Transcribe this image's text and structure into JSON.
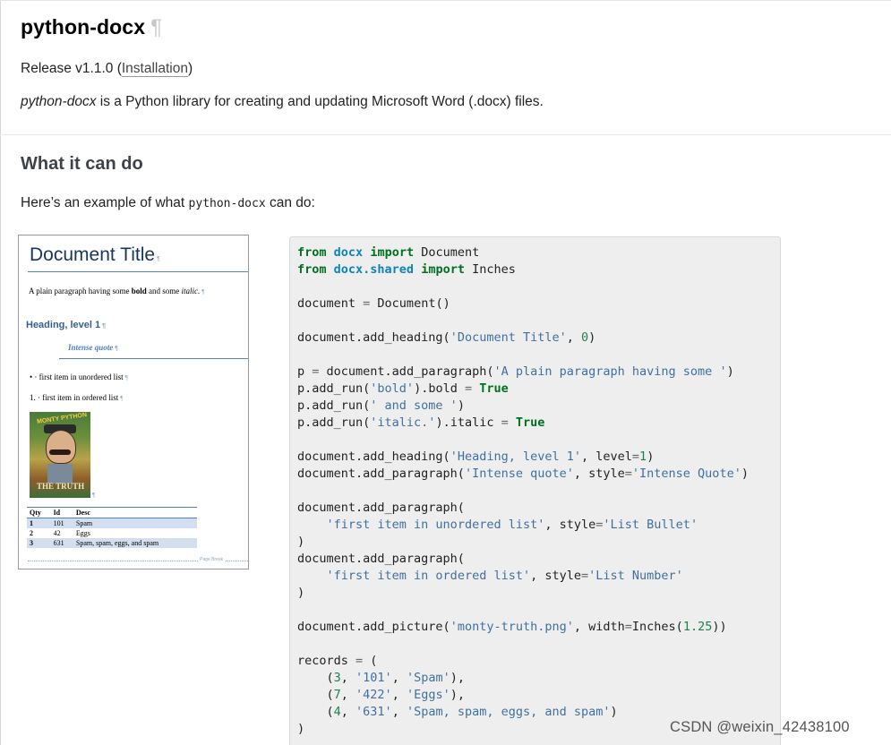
{
  "page": {
    "title": "python-docx",
    "pilcrow": "¶",
    "release_prefix": "Release v1.1.0 (",
    "release_link": "Installation",
    "release_suffix": ")",
    "intro_em": "python-docx",
    "intro_rest": " is a Python library for creating and updating Microsoft Word (.docx) files.",
    "section_heading": "What it can do",
    "example_prefix": "Here’s an example of what ",
    "example_code": "python-docx",
    "example_suffix": " can do:"
  },
  "doc_preview": {
    "title": "Document Title",
    "para_1": "A plain paragraph having some ",
    "para_bold": "bold",
    "para_2": " and some ",
    "para_italic": "italic.",
    "heading": "Heading, level 1",
    "quote": "Intense quote",
    "bullet_item": "• · first item in unordered list",
    "numbered_item": "1. · first item in ordered list",
    "picture_top_text": "MONTY PYTHON",
    "picture_bottom_text": "THE TRUTH",
    "table_headers": [
      "Qty",
      "Id",
      "Desc"
    ],
    "table_rows": [
      [
        "1",
        "101",
        "Spam"
      ],
      [
        "2",
        "42",
        "Eggs"
      ],
      [
        "3",
        "631",
        "Spam, spam, eggs, and spam"
      ]
    ],
    "page_break_label": "Page Break",
    "mark": "¶"
  },
  "code": {
    "lines": [
      [
        [
          "kw",
          "from"
        ],
        [
          "t",
          " "
        ],
        [
          "ns",
          "docx"
        ],
        [
          "t",
          " "
        ],
        [
          "kw",
          "import"
        ],
        [
          "t",
          " Document"
        ]
      ],
      [
        [
          "kw",
          "from"
        ],
        [
          "t",
          " "
        ],
        [
          "ns",
          "docx.shared"
        ],
        [
          "t",
          " "
        ],
        [
          "kw",
          "import"
        ],
        [
          "t",
          " Inches"
        ]
      ],
      [],
      [
        [
          "t",
          "document "
        ],
        [
          "op",
          "="
        ],
        [
          "t",
          " Document()"
        ]
      ],
      [],
      [
        [
          "t",
          "document.add_heading("
        ],
        [
          "str",
          "'Document Title'"
        ],
        [
          "t",
          ", "
        ],
        [
          "num",
          "0"
        ],
        [
          "t",
          ")"
        ]
      ],
      [],
      [
        [
          "t",
          "p "
        ],
        [
          "op",
          "="
        ],
        [
          "t",
          " document.add_paragraph("
        ],
        [
          "str",
          "'A plain paragraph having some '"
        ],
        [
          "t",
          ")"
        ]
      ],
      [
        [
          "t",
          "p.add_run("
        ],
        [
          "str",
          "'bold'"
        ],
        [
          "t",
          ").bold "
        ],
        [
          "op",
          "="
        ],
        [
          "t",
          " "
        ],
        [
          "kw",
          "True"
        ]
      ],
      [
        [
          "t",
          "p.add_run("
        ],
        [
          "str",
          "' and some '"
        ],
        [
          "t",
          ")"
        ]
      ],
      [
        [
          "t",
          "p.add_run("
        ],
        [
          "str",
          "'italic.'"
        ],
        [
          "t",
          ").italic "
        ],
        [
          "op",
          "="
        ],
        [
          "t",
          " "
        ],
        [
          "kw",
          "True"
        ]
      ],
      [],
      [
        [
          "t",
          "document.add_heading("
        ],
        [
          "str",
          "'Heading, level 1'"
        ],
        [
          "t",
          ", level"
        ],
        [
          "op",
          "="
        ],
        [
          "num",
          "1"
        ],
        [
          "t",
          ")"
        ]
      ],
      [
        [
          "t",
          "document.add_paragraph("
        ],
        [
          "str",
          "'Intense quote'"
        ],
        [
          "t",
          ", style"
        ],
        [
          "op",
          "="
        ],
        [
          "str",
          "'Intense Quote'"
        ],
        [
          "t",
          ")"
        ]
      ],
      [],
      [
        [
          "t",
          "document.add_paragraph("
        ]
      ],
      [
        [
          "t",
          "    "
        ],
        [
          "str",
          "'first item in unordered list'"
        ],
        [
          "t",
          ", style"
        ],
        [
          "op",
          "="
        ],
        [
          "str",
          "'List Bullet'"
        ]
      ],
      [
        [
          "t",
          ")"
        ]
      ],
      [
        [
          "t",
          "document.add_paragraph("
        ]
      ],
      [
        [
          "t",
          "    "
        ],
        [
          "str",
          "'first item in ordered list'"
        ],
        [
          "t",
          ", style"
        ],
        [
          "op",
          "="
        ],
        [
          "str",
          "'List Number'"
        ]
      ],
      [
        [
          "t",
          ")"
        ]
      ],
      [],
      [
        [
          "t",
          "document.add_picture("
        ],
        [
          "str",
          "'monty-truth.png'"
        ],
        [
          "t",
          ", width"
        ],
        [
          "op",
          "="
        ],
        [
          "t",
          "Inches("
        ],
        [
          "num",
          "1.25"
        ],
        [
          "t",
          "))"
        ]
      ],
      [],
      [
        [
          "t",
          "records "
        ],
        [
          "op",
          "="
        ],
        [
          "t",
          " ("
        ]
      ],
      [
        [
          "t",
          "    ("
        ],
        [
          "num",
          "3"
        ],
        [
          "t",
          ", "
        ],
        [
          "str",
          "'101'"
        ],
        [
          "t",
          ", "
        ],
        [
          "str",
          "'Spam'"
        ],
        [
          "t",
          "),"
        ]
      ],
      [
        [
          "t",
          "    ("
        ],
        [
          "num",
          "7"
        ],
        [
          "t",
          ", "
        ],
        [
          "str",
          "'422'"
        ],
        [
          "t",
          ", "
        ],
        [
          "str",
          "'Eggs'"
        ],
        [
          "t",
          "),"
        ]
      ],
      [
        [
          "t",
          "    ("
        ],
        [
          "num",
          "4"
        ],
        [
          "t",
          ", "
        ],
        [
          "str",
          "'631'"
        ],
        [
          "t",
          ", "
        ],
        [
          "str",
          "'Spam, spam, eggs, and spam'"
        ],
        [
          "t",
          ")"
        ]
      ],
      [
        [
          "t",
          ")"
        ]
      ]
    ]
  },
  "watermark": "CSDN @weixin_42438100"
}
